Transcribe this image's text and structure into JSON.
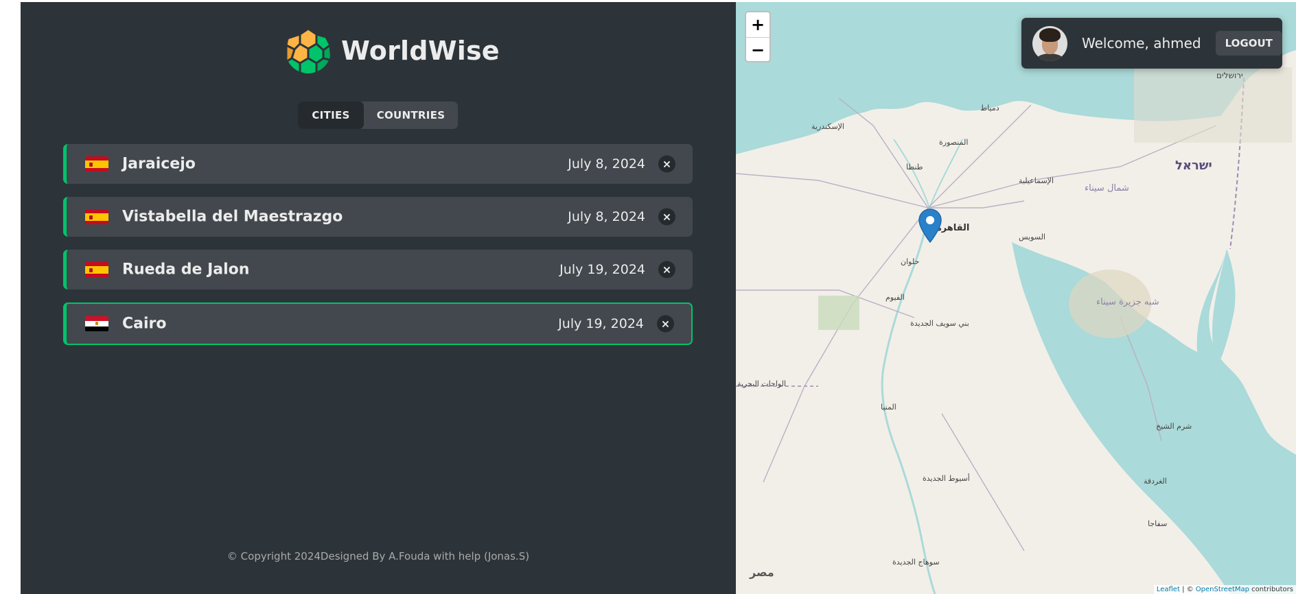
{
  "app": {
    "logo_text": "WorldWise"
  },
  "tabs": {
    "cities": "Cities",
    "countries": "Countries"
  },
  "cities": [
    {
      "name": "Jaraicejo",
      "date": "July 8, 2024",
      "flag": "es",
      "active": false
    },
    {
      "name": "Vistabella del Maestrazgo",
      "date": "July 8, 2024",
      "flag": "es",
      "active": false
    },
    {
      "name": "Rueda de Jalon",
      "date": "July 19, 2024",
      "flag": "es",
      "active": false
    },
    {
      "name": "Cairo",
      "date": "July 19, 2024",
      "flag": "eg",
      "active": true
    }
  ],
  "delete_icon": "×",
  "footer": "© Copyright 2024Designed By A.Fouda with help (Jonas.S)",
  "map": {
    "zoom_in": "+",
    "zoom_out": "−",
    "user": {
      "welcome": "Welcome, ahmed",
      "logout": "Logout"
    },
    "attribution": {
      "leaflet": "Leaflet",
      "separator": " | © ",
      "osm": "OpenStreetMap",
      "suffix": " contributors"
    },
    "labels": {
      "egypt": "مصر",
      "israel": "ישראל",
      "cairo": "القاهرة",
      "alexandria": "الإسكندرية",
      "suez": "السويس",
      "north_sinai": "شمال سيناء",
      "sinai_peninsula": "شبه جزيرة سيناء",
      "hurghada": "الغردقة",
      "sharm": "شرم الشيخ",
      "fayoum": "الفيوم",
      "minya": "المنيا",
      "asyut": "أسيوط الجديدة",
      "sohag": "سوهاج الجديدة",
      "ismailia": "الإسماعيلية",
      "damietta": "دمياط",
      "jerusalem": "ירושלים",
      "beni_suef": "بني سويف الجديدة",
      "helwan": "حلوان",
      "tanta": "طنطا",
      "mansoura": "المنصورة",
      "safaga": "سفاجا",
      "bahariya": "الواحات البحرية"
    }
  },
  "colors": {
    "brand_green": "#00c46a",
    "sidebar_bg": "#2d3439",
    "item_bg": "#42484d",
    "sea": "#aadad9",
    "land": "#f2efe9"
  },
  "icons": [
    "globe-logo-icon",
    "close-icon",
    "map-marker-icon",
    "zoom-in-icon",
    "zoom-out-icon"
  ]
}
